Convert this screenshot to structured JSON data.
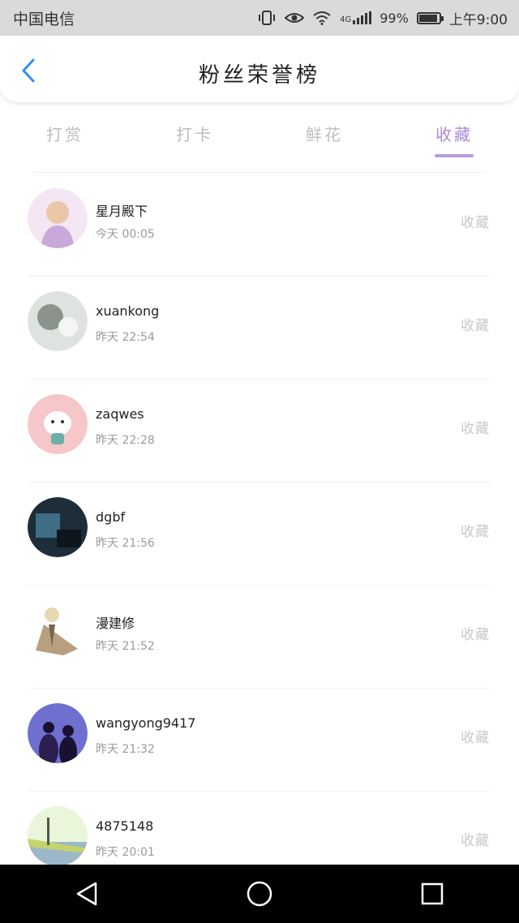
{
  "status_bar": {
    "carrier": "中国电信",
    "network": "4G",
    "battery_percent": "99%",
    "time": "上午9:00",
    "battery_level": 0.99
  },
  "header": {
    "title": "粉丝荣誉榜",
    "back_icon": "chevron-left-icon"
  },
  "tabs": [
    {
      "label": "打赏",
      "active": false
    },
    {
      "label": "打卡",
      "active": false
    },
    {
      "label": "鲜花",
      "active": false
    },
    {
      "label": "收藏",
      "active": true
    }
  ],
  "colors": {
    "accent": "#a98ad6",
    "back_arrow": "#2f8ff0"
  },
  "fans": [
    {
      "name": "星月殿下",
      "time": "今天 00:05",
      "action": "收藏",
      "avatar_colors": [
        "#f4e6f2",
        "#e9c7a8",
        "#c9a9d9"
      ]
    },
    {
      "name": "xuankong",
      "time": "昨天 22:54",
      "action": "收藏",
      "avatar_colors": [
        "#dfe3df",
        "#8a948c",
        "#f4f6f4"
      ]
    },
    {
      "name": "zaqwes",
      "time": "昨天 22:28",
      "action": "收藏",
      "avatar_colors": [
        "#f6c6c9",
        "#ffffff",
        "#6bb0a7"
      ]
    },
    {
      "name": "dgbf",
      "time": "昨天 21:56",
      "action": "收藏",
      "avatar_colors": [
        "#1d2e3a",
        "#3f6e86",
        "#0e161d"
      ]
    },
    {
      "name": "漫建修",
      "time": "昨天 21:52",
      "action": "收藏",
      "avatar_colors": [
        "#ffffff",
        "#b79f80",
        "#7a6450"
      ]
    },
    {
      "name": "wangyong9417",
      "time": "昨天 21:32",
      "action": "收藏",
      "avatar_colors": [
        "#6f6fd0",
        "#2c1e4f",
        "#1a1030"
      ]
    },
    {
      "name": "4875148",
      "time": "昨天 20:01",
      "action": "收藏",
      "avatar_colors": [
        "#e9f6d9",
        "#c5d36b",
        "#9bb7c9"
      ]
    }
  ],
  "nav": {
    "back": "back-triangle-icon",
    "home": "home-circle-icon",
    "recent": "recent-square-icon"
  }
}
